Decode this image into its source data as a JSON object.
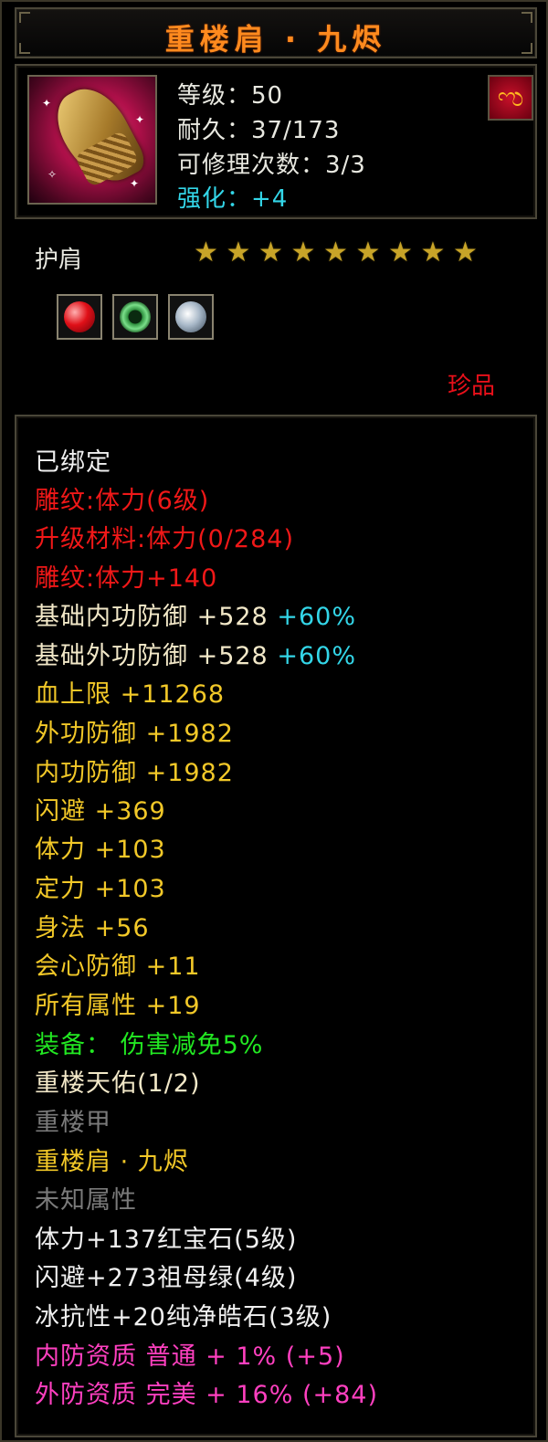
{
  "tooltip": {
    "title": "重楼肩 · 九烬",
    "stats": {
      "level": "等级：50",
      "durability": "耐久：37/173",
      "repairs": "可修理次数：3/3",
      "enhance": "强化：+4"
    },
    "part": "护肩",
    "star_count": 9,
    "rarity": "珍品",
    "gems": [
      "ruby-icon",
      "emerald-icon",
      "diamond-icon"
    ],
    "bound": "已绑定",
    "engraving": "雕纹:体力(6级)",
    "upgrade_material": "升级材料:体力(0/284)",
    "engraving_bonus": "雕纹:体力+140",
    "base_inner_def": {
      "text": "基础内功防御 +528",
      "pct": "+60%"
    },
    "base_outer_def": {
      "text": "基础外功防御 +528",
      "pct": "+60%"
    },
    "attributes": [
      "血上限 +11268",
      "外功防御 +1982",
      "内功防御 +1982",
      "闪避 +369",
      "体力 +103",
      "定力 +103",
      "身法 +56",
      "会心防御 +11",
      "所有属性 +19"
    ],
    "equip_bonus": "装备： 伤害减免5%",
    "set_name": "重楼天佑(1/2)",
    "set_piece_missing": "重楼甲",
    "set_piece_owned": "重楼肩 · 九烬",
    "unknown_attr": "未知属性",
    "gem_lines": [
      "体力+137红宝石(5级)",
      "闪避+273祖母绿(4级)",
      "冰抗性+20纯净皓石(3级)"
    ],
    "quality_lines": [
      "内防资质 普通 + 1% (+5)",
      "外防资质 完美 + 16% (+84)"
    ]
  },
  "colors": {
    "title": "#ff8a1e",
    "enhance": "#33d6e8",
    "red": "#f01818",
    "attribute": "#f2c828",
    "equip": "#22e822",
    "inactive": "#7a7a7a",
    "quality": "#ff40c0"
  }
}
